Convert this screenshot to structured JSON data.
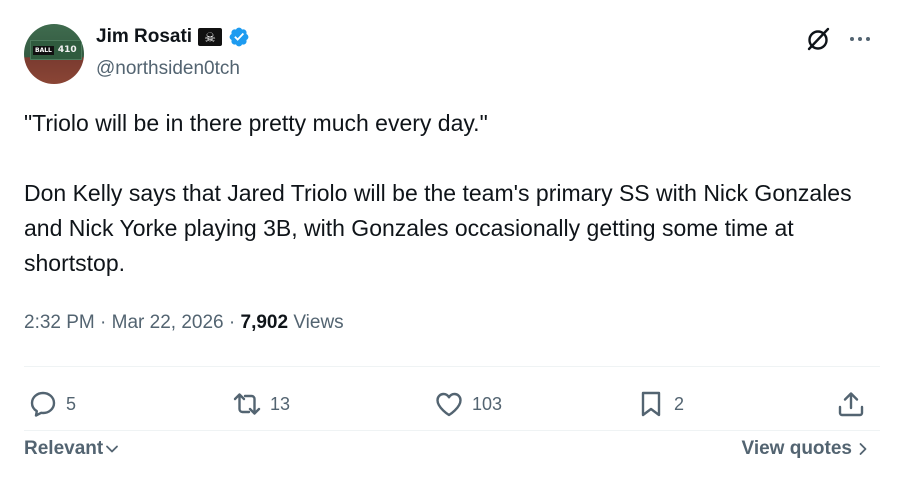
{
  "author": {
    "display_name": "Jim Rosati",
    "flag_emoji": "☠",
    "handle": "@northsiden0tch",
    "avatar_sign": "410",
    "avatar_tag": "BALL"
  },
  "tweet": {
    "quote_line": "\"Triolo will be in there pretty much every day.\"",
    "body": "Don Kelly says that Jared Triolo will be the team's primary SS with Nick Gonzales and Nick Yorke playing 3B, with Gonzales occasionally getting some time at shortstop."
  },
  "meta": {
    "time": "2:32 PM",
    "separator": "·",
    "date": "Mar 22, 2026",
    "views_count": "7,902",
    "views_label": "Views"
  },
  "actions": {
    "replies": "5",
    "reposts": "13",
    "likes": "103",
    "bookmarks": "2"
  },
  "footer": {
    "sort_label": "Relevant",
    "view_quotes_label": "View quotes"
  },
  "colors": {
    "text_primary": "#0f1419",
    "text_secondary": "#536471",
    "verified_blue": "#1d9bf0",
    "divider": "#eff3f4"
  }
}
